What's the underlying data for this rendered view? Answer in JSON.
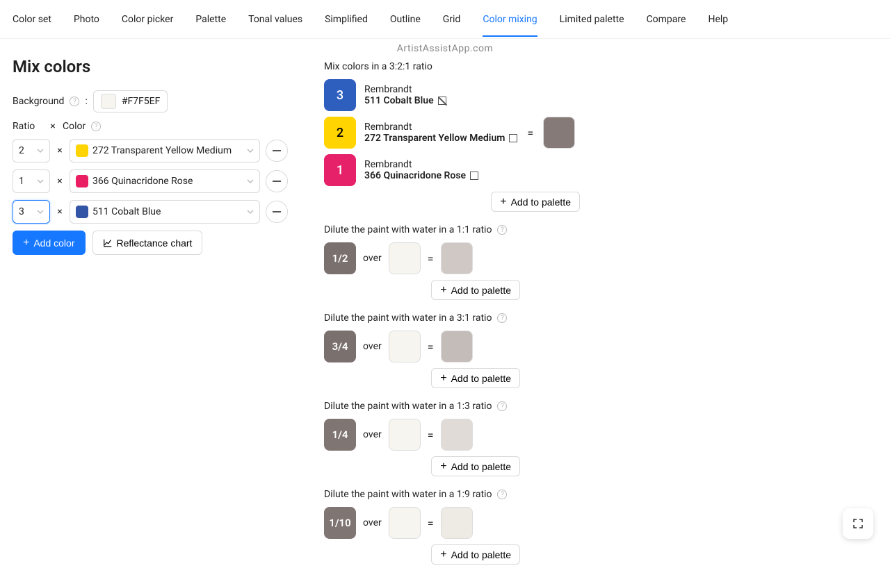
{
  "tabs": [
    "Color set",
    "Photo",
    "Color picker",
    "Palette",
    "Tonal values",
    "Simplified",
    "Outline",
    "Grid",
    "Color mixing",
    "Limited palette",
    "Compare",
    "Help"
  ],
  "active_tab": "Color mixing",
  "site_name": "ArtistAssistApp.com",
  "page_title": "Mix colors",
  "background": {
    "label": "Background",
    "value": "#F7F5EF"
  },
  "headers": {
    "ratio": "Ratio",
    "times": "×",
    "color": "Color"
  },
  "rows": [
    {
      "ratio": "2",
      "swatch": "#FFD400",
      "name": "272 Transparent Yellow Medium",
      "focused": false
    },
    {
      "ratio": "1",
      "swatch": "#E91E63",
      "name": "366 Quinacridone Rose",
      "focused": false
    },
    {
      "ratio": "3",
      "swatch": "#3355A5",
      "name": "511 Cobalt Blue",
      "focused": true
    }
  ],
  "buttons": {
    "add_color": "Add color",
    "reflectance": "Reflectance chart",
    "add_palette": "Add to palette"
  },
  "mix": {
    "title": "Mix colors in a 3:2:1 ratio",
    "ingredients": [
      {
        "ratio": "3",
        "bg": "#2E5FBF",
        "dark": false,
        "brand": "Rembrandt",
        "name": "511 Cobalt Blue",
        "strike": true
      },
      {
        "ratio": "2",
        "bg": "#FFD400",
        "dark": true,
        "brand": "Rembrandt",
        "name": "272 Transparent Yellow Medium",
        "strike": false
      },
      {
        "ratio": "1",
        "bg": "#E6216A",
        "dark": false,
        "brand": "Rembrandt",
        "name": "366 Quinacridone Rose",
        "strike": false
      }
    ],
    "result": "#857A78"
  },
  "dilutions": [
    {
      "title": "Dilute the paint with water in a 1:1 ratio",
      "frac": "1/2",
      "fracbg": "#7A706E",
      "over_bg": "#F7F5EF",
      "result": "#CFC8C5"
    },
    {
      "title": "Dilute the paint with water in a 3:1 ratio",
      "frac": "3/4",
      "fracbg": "#7A706E",
      "over_bg": "#F7F5EF",
      "result": "#C4BCB9"
    },
    {
      "title": "Dilute the paint with water in a 1:3 ratio",
      "frac": "1/4",
      "fracbg": "#7F7573",
      "over_bg": "#F7F5EF",
      "result": "#E0DBD6"
    },
    {
      "title": "Dilute the paint with water in a 1:9 ratio",
      "frac": "1/10",
      "fracbg": "#7F7573",
      "over_bg": "#F7F5EF",
      "result": "#EEEAE4"
    }
  ],
  "over_label": "over",
  "eq": "="
}
